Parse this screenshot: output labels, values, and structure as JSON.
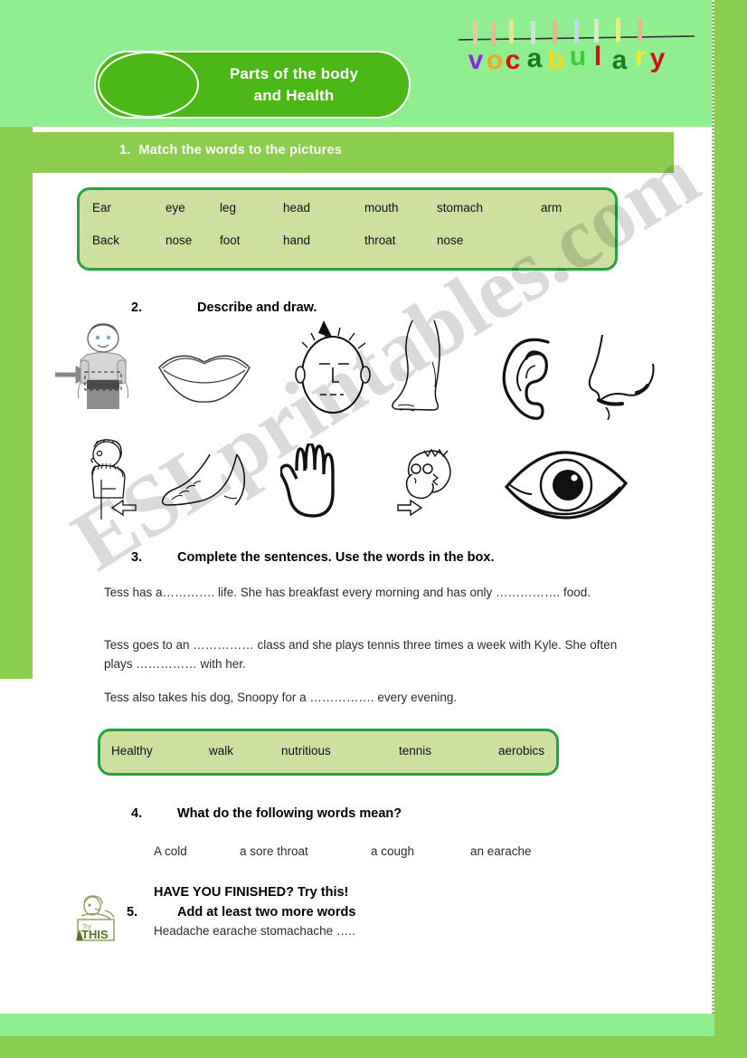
{
  "title": {
    "line1": "Parts of the body",
    "line2": "and  Health"
  },
  "decor": {
    "vocab_art": "hanging-letters-vocabulary",
    "watermark": "ESLprintables.com"
  },
  "exercise1": {
    "number": "1.",
    "heading": "Match the words to the pictures",
    "wordbox": {
      "row1": [
        "Ear",
        "eye",
        "leg",
        "head",
        "mouth",
        "stomach",
        "arm"
      ],
      "row2": [
        "Back",
        "nose",
        "foot",
        "hand",
        "throat",
        "nose"
      ]
    }
  },
  "exercise2": {
    "number": "2.",
    "heading": "Describe and draw.",
    "pictures_row1": [
      "stomach",
      "mouth",
      "head",
      "leg",
      "ear",
      "nose"
    ],
    "pictures_row2": [
      "back",
      "foot",
      "hand",
      "throat",
      "eye"
    ]
  },
  "exercise3": {
    "number": "3.",
    "heading": "Complete the sentences. Use the words in the box.",
    "sentences": [
      "Tess has a…………. life. She has breakfast every morning and has only ……………. food.",
      "Tess goes to an …………… class and she plays tennis three times a week with Kyle. She often plays …………… with her.",
      "Tess also takes his dog, Snoopy for a ……………. every evening."
    ],
    "wordbox": [
      "Healthy",
      "walk",
      "nutritious",
      "tennis",
      "aerobics"
    ]
  },
  "exercise4": {
    "number": "4.",
    "heading": "What do the following words mean?",
    "words": [
      "A cold",
      "a sore throat",
      "a cough",
      "an earache"
    ]
  },
  "exercise5": {
    "banner": "HAVE YOU FINISHED? Try this!",
    "number": "5.",
    "heading": "Add at least two more words",
    "words": "Headache   earache   stomachache …..",
    "icon_label": "try-this-sign"
  },
  "colors": {
    "band_light": "#90ee90",
    "band_mid": "#8bce4f",
    "pill": "#4cb818",
    "box_fill": "#cde0a0",
    "box_border": "#27a23f"
  }
}
